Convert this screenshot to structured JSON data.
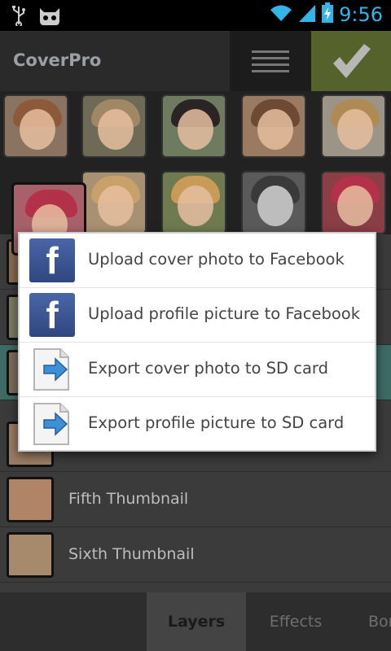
{
  "status_bar": {
    "time": "9:56",
    "icons": [
      "usb-icon",
      "android-cyanogen-icon",
      "wifi-icon",
      "signal-icon",
      "battery-charging-icon"
    ]
  },
  "action_bar": {
    "title": "CoverPro",
    "menu_icon": "menu-lines-icon",
    "confirm_icon": "checkmark-icon",
    "colors": {
      "confirm": "#56622c"
    }
  },
  "photo_grid": {
    "rows": 2,
    "columns": 5
  },
  "popup": {
    "items": [
      {
        "icon": "facebook-icon",
        "label": "Upload cover photo to Facebook"
      },
      {
        "icon": "facebook-icon",
        "label": "Upload profile picture to Facebook"
      },
      {
        "icon": "export-file-icon",
        "label": "Export cover photo to SD card"
      },
      {
        "icon": "export-file-icon",
        "label": "Export profile picture to SD card"
      }
    ]
  },
  "list": {
    "items": [
      {
        "label": ""
      },
      {
        "label": ""
      },
      {
        "label": ""
      },
      {
        "label": ""
      },
      {
        "label": "Fifth Thumbnail"
      },
      {
        "label": "Sixth Thumbnail"
      }
    ]
  },
  "tabs": [
    {
      "label": "Layers",
      "active": true
    },
    {
      "label": "Effects",
      "active": false
    },
    {
      "label": "Bor",
      "active": false
    }
  ]
}
